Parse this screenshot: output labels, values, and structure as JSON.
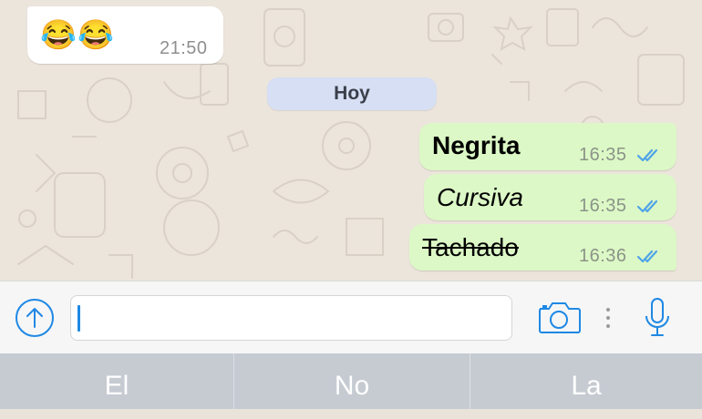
{
  "messages": {
    "incoming": {
      "emoji": [
        "😂",
        "😂"
      ],
      "time": "21:50"
    },
    "date_separator": "Hoy",
    "outgoing": [
      {
        "text": "Negrita",
        "style": "bold",
        "time": "16:35",
        "status": "read"
      },
      {
        "text": "Cursiva",
        "style": "italic",
        "time": "16:35",
        "status": "read"
      },
      {
        "text": "Tachado",
        "style": "strikethrough",
        "time": "16:36",
        "status": "read"
      }
    ]
  },
  "input_bar": {
    "message_value": "",
    "icons": [
      "upload-arrow-icon",
      "camera-icon",
      "more-dots-icon",
      "microphone-icon"
    ]
  },
  "keyboard": {
    "suggestions": [
      "El",
      "No",
      "La"
    ]
  },
  "colors": {
    "chat_background": "#ece5dc",
    "outgoing_bubble": "#dcf8c6",
    "incoming_bubble": "#ffffff",
    "date_pill": "#d6dff3",
    "accent": "#1e88e5",
    "read_ticks": "#4fa4e8"
  }
}
